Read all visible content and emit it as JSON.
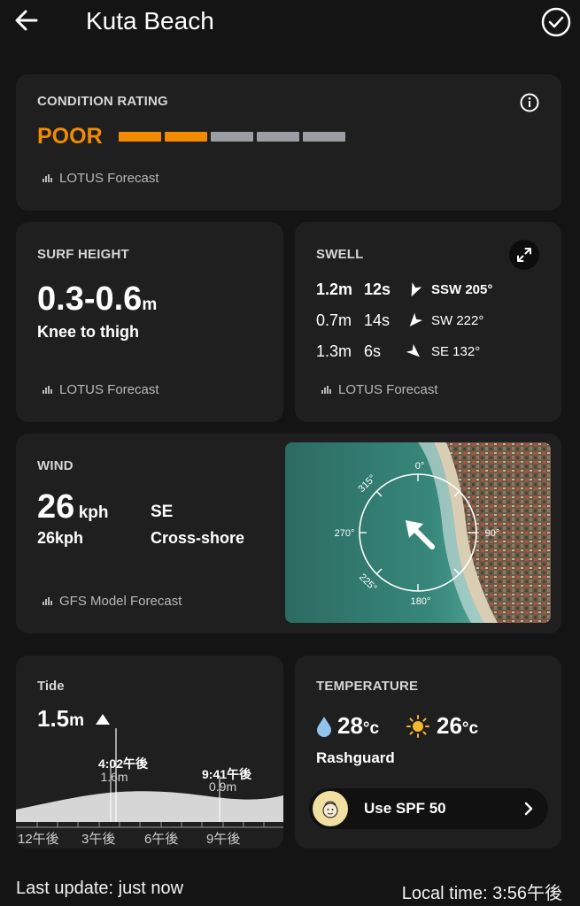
{
  "header": {
    "title": "Kuta Beach"
  },
  "condition": {
    "label": "CONDITION RATING",
    "rating": "POOR",
    "rating_color": "#f28b00",
    "segments_filled": 2,
    "segments_total": 5,
    "source": "LOTUS Forecast"
  },
  "surf": {
    "label": "SURF HEIGHT",
    "value": "0.3-0.6",
    "unit": "m",
    "description": "Knee to thigh",
    "source": "LOTUS Forecast"
  },
  "swell": {
    "label": "SWELL",
    "rows": [
      {
        "height": "1.2m",
        "period": "12s",
        "direction": "SSW 205°",
        "bold": true,
        "degrees": 205
      },
      {
        "height": "0.7m",
        "period": "14s",
        "direction": "SW 222°",
        "bold": false,
        "degrees": 222
      },
      {
        "height": "1.3m",
        "period": "6s",
        "direction": "SE 132°",
        "bold": false,
        "degrees": 132
      }
    ],
    "source": "LOTUS Forecast"
  },
  "wind": {
    "label": "WIND",
    "speed": "26",
    "speed_unit": "kph",
    "gust": "26kph",
    "direction": "SE",
    "relation": "Cross-shore",
    "source": "GFS Model Forecast",
    "compass": {
      "n": "0°",
      "nw": "315°",
      "w": "270°",
      "e": "90°",
      "sw": "225°",
      "s": "180°"
    }
  },
  "tide": {
    "label": "Tide",
    "value": "1.5",
    "unit": "m",
    "high": {
      "time": "4:02午後",
      "height": "1.6m"
    },
    "low": {
      "time": "9:41午後",
      "height": "0.9m"
    },
    "axis": [
      "12午後",
      "3午後",
      "6午後",
      "9午後"
    ]
  },
  "temperature": {
    "label": "TEMPERATURE",
    "water": "28",
    "air": "26",
    "unit": "°c",
    "wear": "Rashguard",
    "spf_label": "Use SPF 50"
  },
  "footer": {
    "last_update": "Last update: just now",
    "local_time": "Local time: 3:56午後"
  }
}
